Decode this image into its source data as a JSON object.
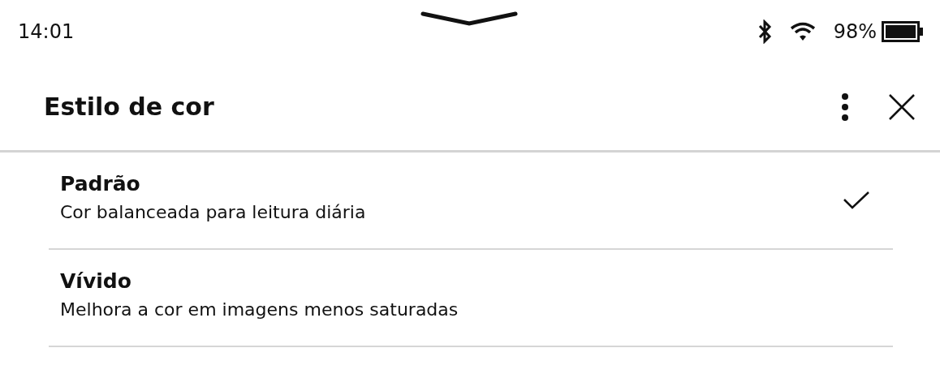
{
  "status_bar": {
    "time": "14:01",
    "battery": "98%"
  },
  "header": {
    "title": "Estilo de cor"
  },
  "options": [
    {
      "title": "Padrão",
      "description": "Cor balanceada para leitura diária",
      "selected": true
    },
    {
      "title": "Vívido",
      "description": "Melhora a cor em imagens menos saturadas",
      "selected": false
    }
  ]
}
